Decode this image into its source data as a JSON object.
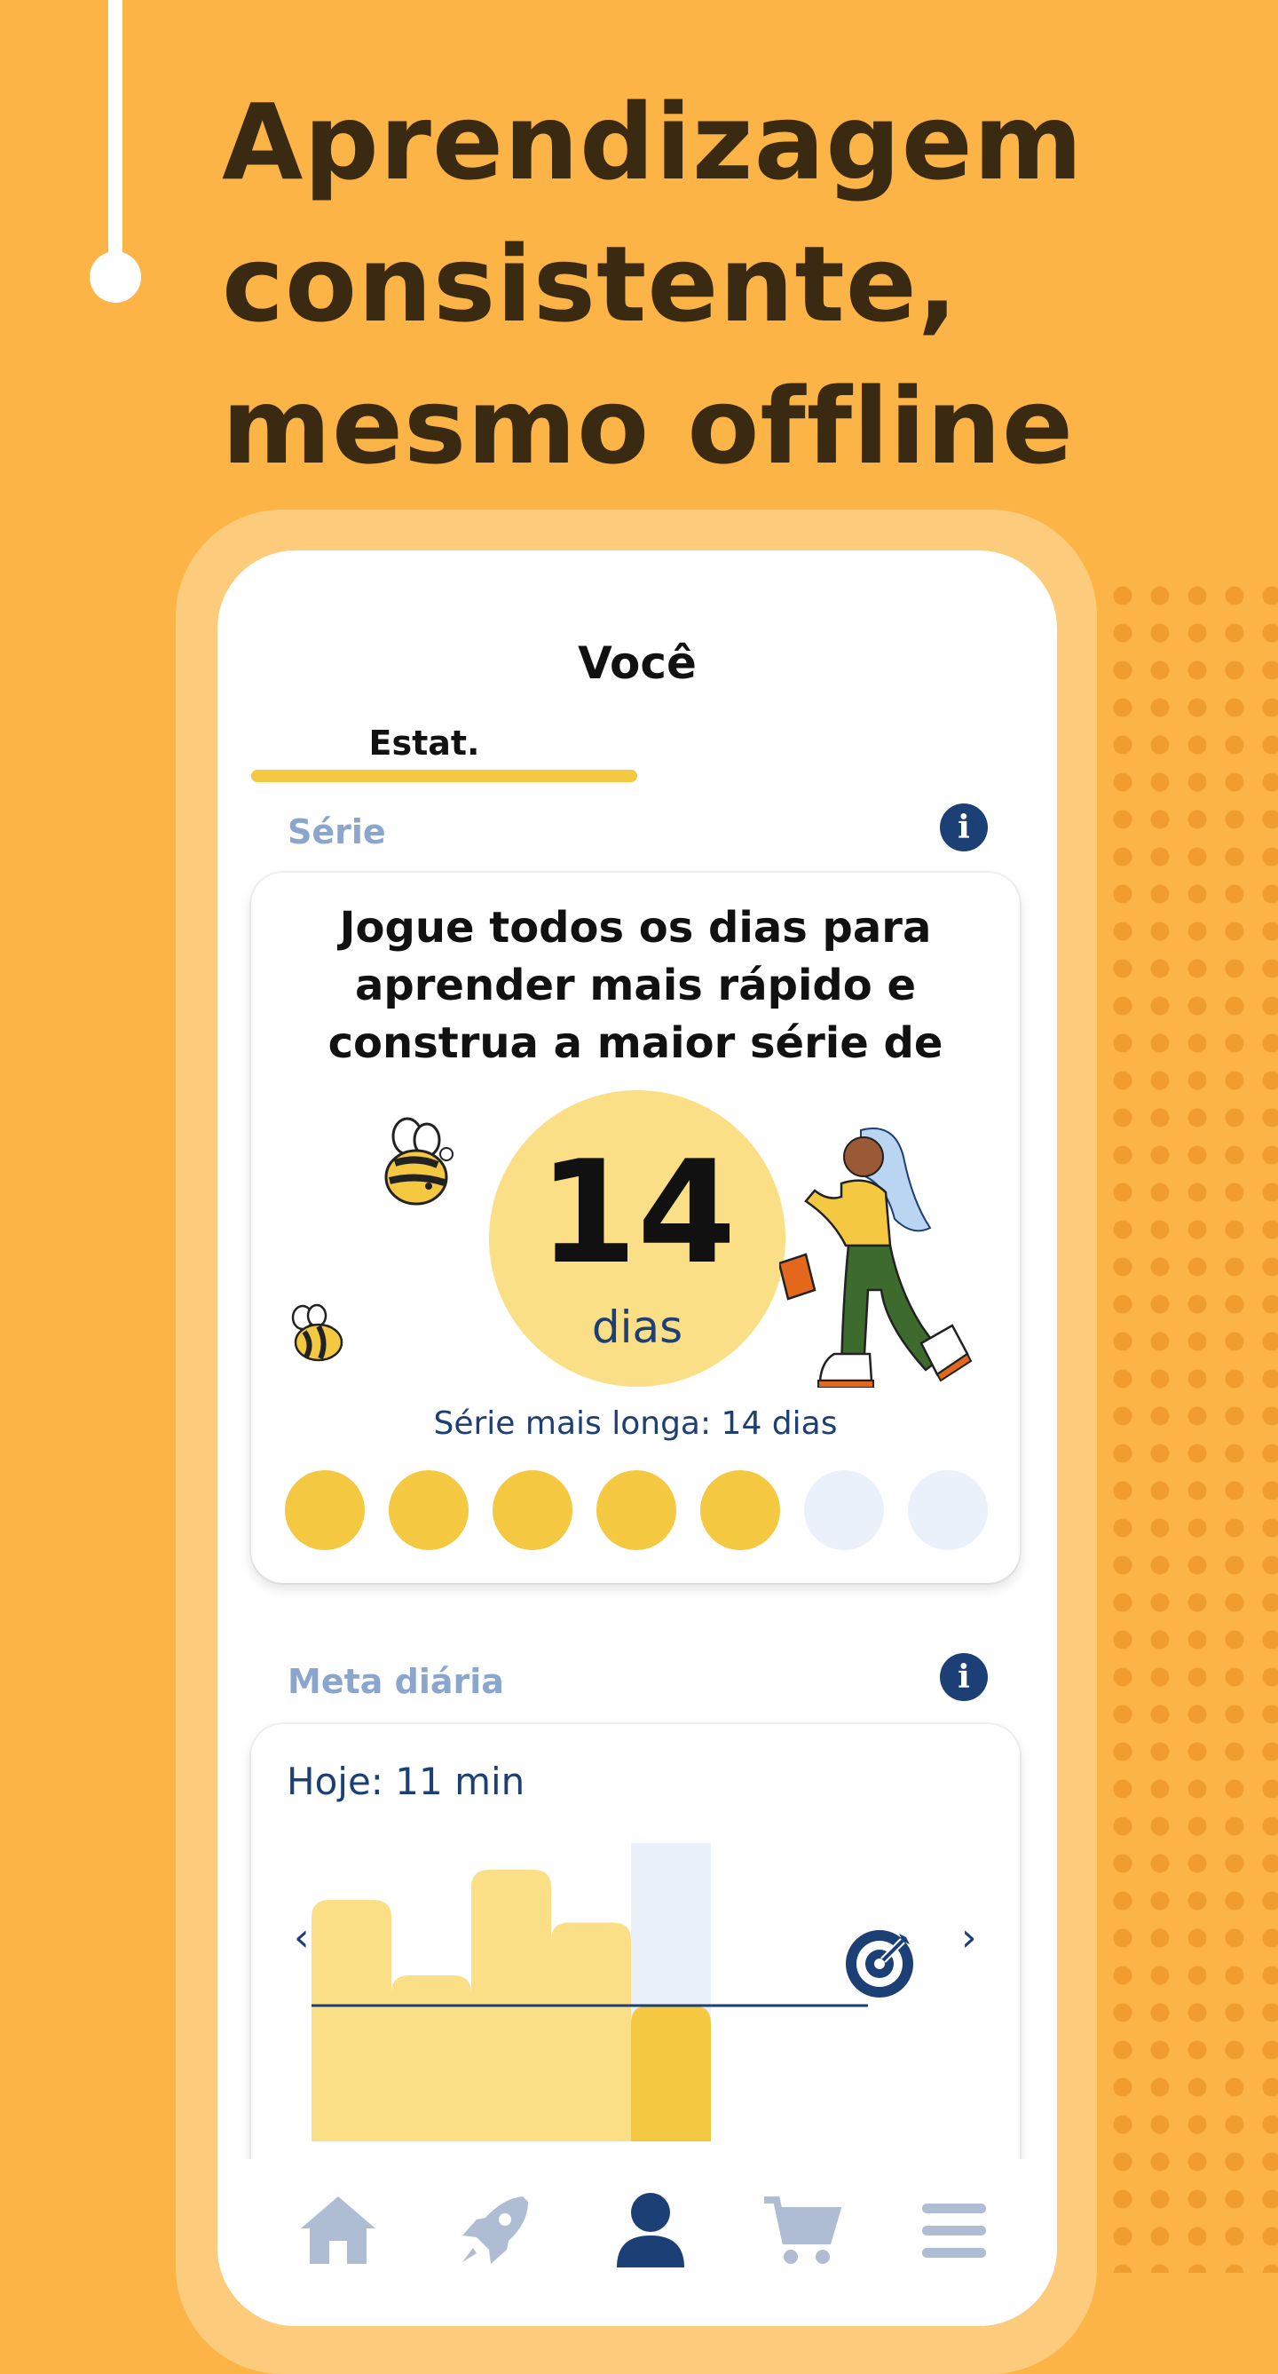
{
  "headline": "Aprendizagem consistente, mesmo offline",
  "screen": {
    "title": "Você",
    "tab_label": "Estat.",
    "streak": {
      "section_label": "Série",
      "message": "Jogue todos os dias para aprender mais rápido e construa a maior série de",
      "count": "14",
      "unit": "dias",
      "longest": "Série mais longa: 14 dias",
      "week_days_completed": [
        true,
        true,
        true,
        true,
        true,
        false,
        false
      ]
    },
    "daily_goal": {
      "section_label": "Meta diária",
      "today": "Hoje: 11 min",
      "prev_arrow": "‹",
      "next_arrow": "›"
    }
  },
  "chart_data": {
    "type": "bar",
    "categories": [
      "",
      "",
      "",
      "",
      ""
    ],
    "values": [
      32,
      22,
      36,
      29,
      18
    ],
    "goal": 18,
    "ylim": [
      0,
      40
    ]
  },
  "colors": {
    "background": "#FDB446",
    "accent_yellow": "#F5C842",
    "light_yellow": "#FADF87",
    "navy": "#1C3F75",
    "muted_blue": "#8AA6CC",
    "inactive_dot": "#EAF1FB",
    "nav_inactive": "#AEBDD3",
    "nav_active": "#1C3F75"
  },
  "nav": [
    {
      "name": "home-icon"
    },
    {
      "name": "rocket-icon"
    },
    {
      "name": "user-icon",
      "active": true
    },
    {
      "name": "cart-icon"
    },
    {
      "name": "menu-icon"
    }
  ]
}
